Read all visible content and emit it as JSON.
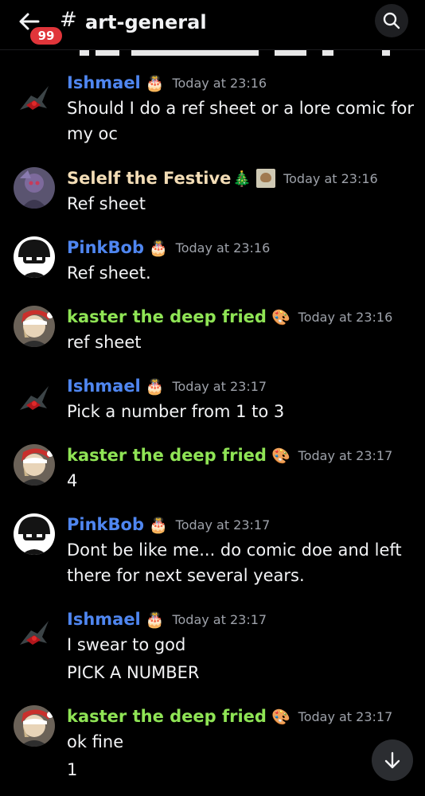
{
  "header": {
    "badge": "99",
    "hash": "#",
    "channel": "art-general",
    "chevron": "›"
  },
  "messages": [
    {
      "author": "Ishmael",
      "badge_emoji": "🎂",
      "time": "Today at 23:16",
      "lines": [
        "Should I do a ref sheet or a lore comic for",
        "my oc"
      ]
    },
    {
      "author": "Selelf the Festive",
      "badge_emoji": "🎄",
      "time": "Today at 23:16",
      "lines": [
        "Ref sheet"
      ]
    },
    {
      "author": "PinkBob",
      "badge_emoji": "🎂",
      "time": "Today at 23:16",
      "lines": [
        "Ref sheet."
      ]
    },
    {
      "author": "kaster the deep fried",
      "badge_emoji": "🎨",
      "time": "Today at 23:16",
      "lines": [
        "ref sheet"
      ]
    },
    {
      "author": "Ishmael",
      "badge_emoji": "🎂",
      "time": "Today at 23:17",
      "lines": [
        "Pick a number from 1 to 3"
      ]
    },
    {
      "author": "kaster the deep fried",
      "badge_emoji": "🎨",
      "time": "Today at 23:17",
      "lines": [
        "4"
      ]
    },
    {
      "author": "PinkBob",
      "badge_emoji": "🎂",
      "time": "Today at 23:17",
      "lines": [
        "Dont be like me... do comic doe and left",
        "there for next several years."
      ]
    },
    {
      "author": "Ishmael",
      "badge_emoji": "🎂",
      "time": "Today at 23:17",
      "lines": [
        "I swear to god",
        "PICK A NUMBER"
      ]
    },
    {
      "author": "kaster the deep fried",
      "badge_emoji": "🎨",
      "time": "Today at 23:17",
      "lines": [
        "ok fine",
        "1"
      ]
    }
  ],
  "colors": {
    "background": "#000000",
    "ishmael": "#4f86f0",
    "selelf": "#f3ddb6",
    "pinkbob": "#4f86f0",
    "kaster": "#8fe455",
    "timestamp": "#9ea2aa",
    "badge": "#e0353a"
  },
  "icons": [
    "back-arrow-icon",
    "search-icon",
    "scroll-down-arrow-icon"
  ]
}
